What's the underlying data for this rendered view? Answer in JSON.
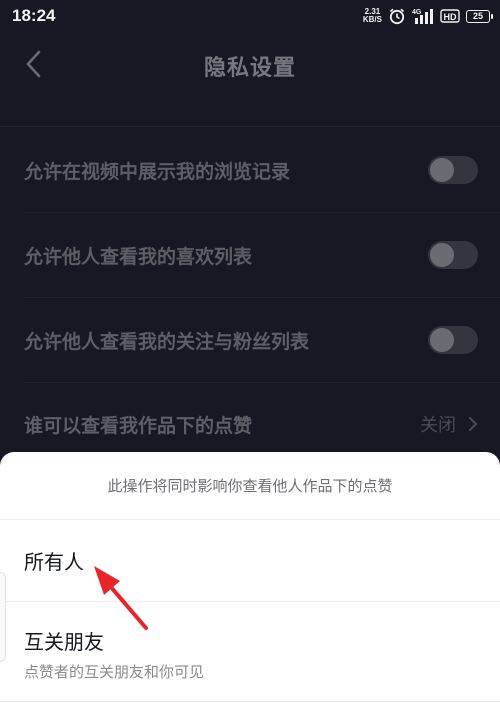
{
  "status_bar": {
    "time": "18:24",
    "net_speed_value": "2.31",
    "net_speed_unit": "KB/S",
    "network_type": "4G",
    "hd_label": "HD",
    "battery_level": "25",
    "icons": [
      "alarm-icon",
      "signal-icon",
      "hd-icon",
      "battery-icon"
    ]
  },
  "header": {
    "title": "隐私设置",
    "back_icon": "chevron-left-icon"
  },
  "settings": [
    {
      "label": "允许在视频中展示我的浏览记录",
      "type": "toggle",
      "enabled": false
    },
    {
      "label": "允许他人查看我的喜欢列表",
      "type": "toggle",
      "enabled": false
    },
    {
      "label": "允许他人查看我的关注与粉丝列表",
      "type": "toggle",
      "enabled": false
    },
    {
      "label": "谁可以查看我作品下的点赞",
      "type": "select",
      "value": "关闭"
    }
  ],
  "sheet": {
    "hint": "此操作将同时影响你查看他人作品下的点赞",
    "options": [
      {
        "title": "所有人"
      },
      {
        "title": "互关朋友",
        "subtitle": "点赞者的互关朋友和你可见"
      }
    ]
  },
  "colors": {
    "background": "#161823",
    "sheet": "#ffffff",
    "annotation_arrow": "#e8262a"
  }
}
